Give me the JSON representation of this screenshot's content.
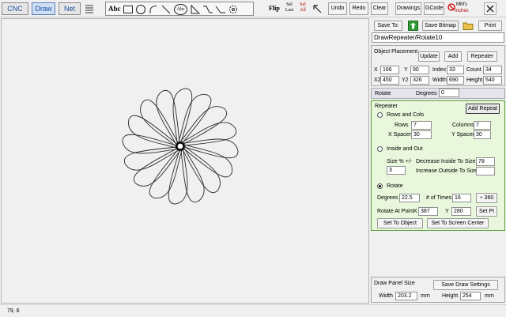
{
  "tabs": [
    "CNC",
    "Draw",
    "Net"
  ],
  "toolbar": {
    "abc_label": "Abc",
    "abc_circle_label": "Abc",
    "flip_label": "Flip",
    "sel_last_label": "Sel Last",
    "sel_all_label": "Sel All",
    "undo_label": "Undo",
    "redo_label": "Redo",
    "clear_label": "Clear",
    "drawings_label": "Drawings",
    "gcode_label": "GCode",
    "units_top": "MM's",
    "units_bottom": "Inches"
  },
  "panel": {
    "save_to_label": "Save To:",
    "save_bitmap_label": "Save Bitmap",
    "print_label": "Print",
    "drawing_name": "DrawRepeater/Rotate10",
    "object_placement": {
      "title": "Object Placement",
      "update_label": "Update",
      "add_label": "Add",
      "repeater_label": "Repeater",
      "x_label": "X",
      "x_value": "166",
      "y_label": "Y",
      "y_value": "90",
      "index_label": "Index",
      "index_value": "33",
      "count_label": "Count",
      "count_value": "34",
      "x2_label": "X2",
      "x2_value": "450",
      "y2_label": "Y2",
      "y2_value": "326",
      "width_label": "Width",
      "width_value": "690",
      "height_label": "Height",
      "height_value": "540"
    },
    "rotate_row": {
      "title": "Rotate",
      "degrees_label": "Degrees",
      "degrees_value": "0"
    },
    "repeater": {
      "title": "Repeater",
      "add_repeat_label": "Add Repeat",
      "rows_cols_label": "Rows and Cols",
      "rows_label": "Rows",
      "rows_value": "7",
      "columns_label": "Columns",
      "columns_value": "7",
      "x_spacer_label": "X Spacer",
      "x_spacer_value": "30",
      "y_spacer_label": "Y Spacer",
      "y_spacer_value": "30",
      "inside_out_label": "Inside and Out",
      "size_pct_label": "Size % +/-",
      "size_pct_value": "3",
      "decrease_label": "Decrease Inside To Size %",
      "decrease_value": "78",
      "increase_label": "Increase Outside To Size %",
      "increase_value": "",
      "rotate_label": "Rotate",
      "degrees_label": "Degrees",
      "degrees_value": "22.5",
      "times_label": "# of Times",
      "times_value": "16",
      "div360_label": "÷ 360",
      "rotate_at_label": "Rotate At Point",
      "rx_label": "X",
      "rx_value": "387",
      "ry_label": "Y",
      "ry_value": "280",
      "set_pt_label": "Set Pt",
      "set_to_object_label": "Set To Object",
      "set_to_center_label": "Set To Screen Center",
      "selected_mode": "Rotate"
    },
    "draw_panel": {
      "title": "Draw Panel Size",
      "save_settings_label": "Save Draw Settings",
      "width_label": "Width",
      "width_value": "203.2",
      "width_unit": "mm",
      "height_label": "Height",
      "height_value": "254",
      "height_unit": "mm"
    }
  },
  "status": {
    "coords": "79, 6"
  },
  "colors": {
    "repeater_bg": "#e9f7dc",
    "repeater_border": "#5aa03c",
    "accent": "#1f4fa0",
    "highlight": "#d8f0b8"
  },
  "drawing": {
    "petal_count": 16,
    "rotate_degrees": 22.5
  }
}
